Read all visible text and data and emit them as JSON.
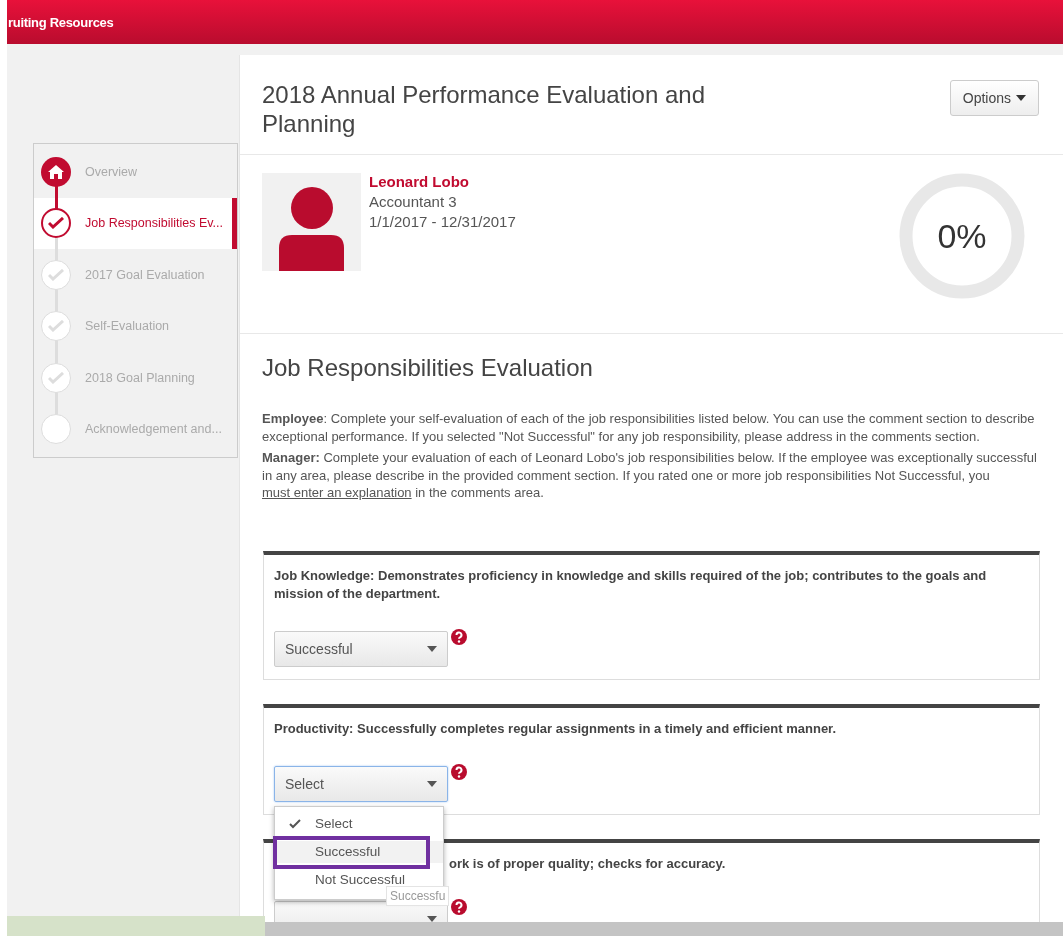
{
  "header": {
    "title": "ruiting Resources"
  },
  "steps": [
    {
      "label": "Overview",
      "kind": "home",
      "selected": false
    },
    {
      "label": "Job Responsibilities Ev...",
      "kind": "current",
      "selected": true
    },
    {
      "label": "2017 Goal Evaluation",
      "kind": "done",
      "selected": false
    },
    {
      "label": "Self-Evaluation",
      "kind": "done",
      "selected": false
    },
    {
      "label": "2018 Goal Planning",
      "kind": "done",
      "selected": false
    },
    {
      "label": "Acknowledgement and...",
      "kind": "todo",
      "selected": false
    }
  ],
  "page": {
    "title": "2018 Annual Performance Evaluation and Planning",
    "options_button": "Options"
  },
  "profile": {
    "name": "Leonard Lobo",
    "position": "Accountant 3",
    "period": "1/1/2017 - 12/31/2017",
    "progress": "0%",
    "level": 0
  },
  "section": {
    "title": "Job Responsibilities Evaluation",
    "instructions": [
      "**Employee**: Complete your self-evaluation of each of the job responsibilities listed below.  You can use the comment section to describe exceptional performance.  If you selected \"Not Successful\" for any job responsibility, please address in the comments section.",
      "**Manager:** Complete your evaluation of each of Leonard Lobo's job responsibilities below.  If the employee was exceptionally successful in any area, please describe in the provided comment section. If you rated one or more job responsibilities Not Successful, you "
    ],
    "link": "must enter an explanation",
    "after_link": " in the comments area."
  },
  "responsibilities": [
    {
      "question": "Job Knowledge: Demonstrates proficiency in knowledge and skills required of the job; contributes to the goals and mission of the department.",
      "value": "Successful",
      "focused": false
    },
    {
      "question": "Productivity: Successfully completes regular assignments in a timely and efficient manner.",
      "value": "Select",
      "focused": true,
      "options": [
        {
          "label": "Select",
          "selected": true,
          "highlighted": false
        },
        {
          "label": "Successful",
          "selected": false,
          "highlighted": true
        },
        {
          "label": "Not Successful",
          "selected": false,
          "highlighted": false
        }
      ]
    },
    {
      "question": "ork is of proper quality; checks for accuracy.",
      "focused": false
    }
  ],
  "tooltip": "Successfu"
}
